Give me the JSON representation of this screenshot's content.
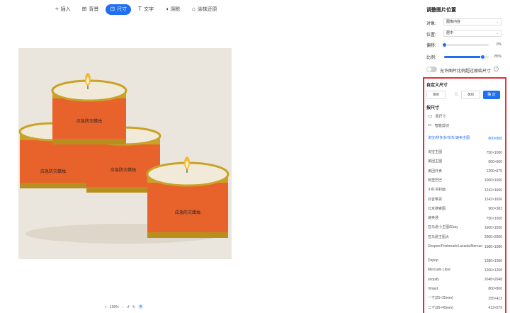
{
  "toolbar": {
    "items": [
      {
        "icon": "plus-icon",
        "glyph": "+",
        "label": "插入"
      },
      {
        "icon": "grid-icon",
        "glyph": "⊞",
        "label": "背景"
      },
      {
        "icon": "crop-icon",
        "glyph": "⊡",
        "label": "尺寸"
      },
      {
        "icon": "text-icon",
        "glyph": "T",
        "label": "文字"
      },
      {
        "icon": "shadow-icon",
        "glyph": "◑",
        "label": "阴影"
      },
      {
        "icon": "restore-icon",
        "glyph": "⌂",
        "label": "涂抹还原"
      }
    ],
    "active_index": 2
  },
  "zoom": {
    "minus": "+",
    "value": "100%",
    "plus": "−",
    "a": "↺",
    "b": "↻",
    "fit": "⊕"
  },
  "photo": {
    "candle_label": "应急防灾蜡烛"
  },
  "panel": {
    "title": "调整图片位置",
    "object_label": "对象:",
    "object_value": "图像内容",
    "position_label": "位置:",
    "position_value": "居中",
    "offset_label": "偏移:",
    "offset_value": "0%",
    "offset_level": 0,
    "scale_label": "比例:",
    "scale_value": "85%",
    "scale_level": 0.85,
    "toggle_label": "允许图片比例超过原始尺寸",
    "toggle_on": false
  },
  "custom_size": {
    "title": "自定义尺寸",
    "width": "800",
    "height": "800",
    "confirm": "确 定"
  },
  "by_size": {
    "title": "按尺寸",
    "original": "原尺寸",
    "smart_crop": "智能剪切",
    "presets": [
      {
        "name": "淘宝/拼多多/京东/速卖主图",
        "size": "800×800",
        "selected": true
      },
      {
        "name": "淘宝主图",
        "size": "750×1000"
      },
      {
        "name": "美团主图",
        "size": "600×600"
      },
      {
        "name": "美团外卖",
        "size": "1200×675"
      },
      {
        "name": "阿里巴巴",
        "size": "1000×1000"
      },
      {
        "name": "小红书封面",
        "size": "1242×1660"
      },
      {
        "name": "抖音带货",
        "size": "1242×1656"
      },
      {
        "name": "北京搜索图",
        "size": "900×383"
      },
      {
        "name": "速卖通",
        "size": "750×1000"
      },
      {
        "name": "亚马逊小主图/Ebay",
        "size": "1600×1650"
      },
      {
        "name": "亚马逊主图大",
        "size": "2000×2000"
      },
      {
        "name": "Shopee/Poshmark/Lazada/Mercari",
        "size": "1080×1080"
      },
      {
        "name": "Depop",
        "size": "1280×1280"
      },
      {
        "name": "Mercado Libre",
        "size": "1200×1200"
      },
      {
        "name": "shopify",
        "size": "2048×2048"
      },
      {
        "name": "Vinted",
        "size": "800×800"
      },
      {
        "name": "一寸(25×35mm)",
        "size": "295×413"
      },
      {
        "name": "二寸(35×49mm)",
        "size": "413×579"
      }
    ]
  },
  "colors": {
    "accent": "#1f6ff0",
    "highlight_border": "#e53030",
    "candle_tin": "#e8632c",
    "gold": "#c9a227"
  }
}
